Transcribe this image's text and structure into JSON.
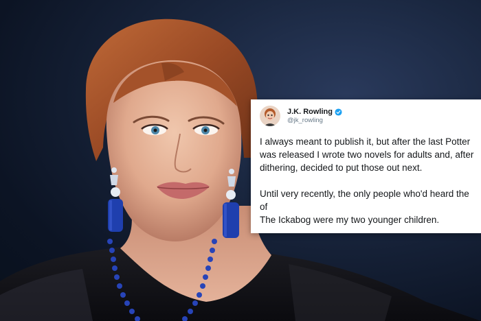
{
  "tweet": {
    "display_name": "J.K. Rowling",
    "handle": "@jk_rowling",
    "verified": true,
    "lines": [
      "I always meant to publish it, but after the last Potter",
      "was released I wrote two novels for adults and, after",
      "dithering, decided to put those out next.",
      "",
      "Until very recently, the only people who'd heard the",
      "of",
      "The Ickabog were my two younger children."
    ],
    "accent_color": "#1da1f2"
  },
  "photo": {
    "background_color": "#1a2740",
    "hair_color": "#a0522d",
    "earring_color": "#1f3fae"
  }
}
